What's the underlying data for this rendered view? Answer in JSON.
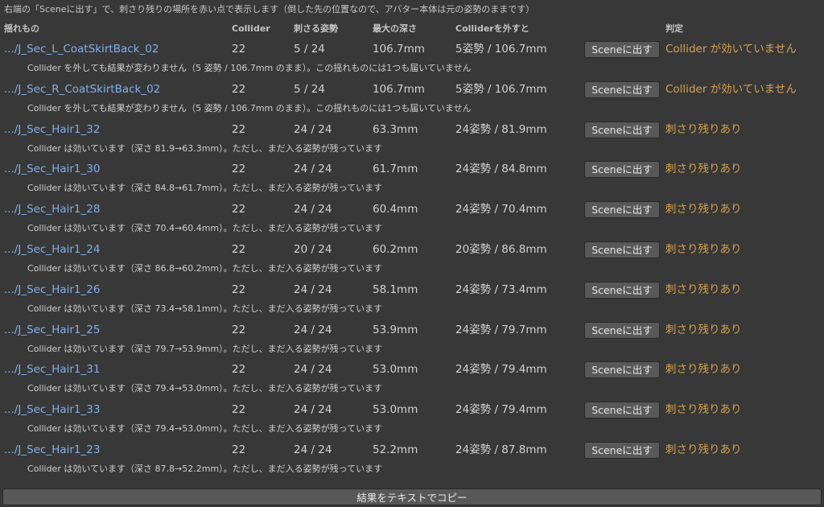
{
  "hint": "右端の「Sceneに出す」で、刺さり残りの場所を赤い点で表示します（倒した先の位置なので、アバター本体は元の姿勢のままです）",
  "header": {
    "col_bone": "揺れもの",
    "col_collider": "Collider",
    "col_poses": "刺さる姿勢",
    "col_depth": "最大の深さ",
    "col_remove": "Colliderを外すと",
    "col_verdict": "判定"
  },
  "colors": {
    "background": "#383838",
    "link": "#7fb0ea",
    "verdict": "#d6a24a",
    "button": "#585858"
  },
  "rows": [
    {
      "name": ".../J_Sec_L_CoatSkirtBack_02",
      "collider": "22",
      "poses": "5 / 24",
      "depth": "106.7mm",
      "remove": "5姿勢 / 106.7mm",
      "button": "Sceneに出す",
      "verdict": "Collider が効いていません",
      "detail": "Collider を外しても結果が変わりません（5 姿勢 / 106.7mm のまま）。この揺れものには1つも届いていません"
    },
    {
      "name": ".../J_Sec_R_CoatSkirtBack_02",
      "collider": "22",
      "poses": "5 / 24",
      "depth": "106.7mm",
      "remove": "5姿勢 / 106.7mm",
      "button": "Sceneに出す",
      "verdict": "Collider が効いていません",
      "detail": "Collider を外しても結果が変わりません（5 姿勢 / 106.7mm のまま）。この揺れものには1つも届いていません"
    },
    {
      "name": ".../J_Sec_Hair1_32",
      "collider": "22",
      "poses": "24 / 24",
      "depth": "63.3mm",
      "remove": "24姿勢 / 81.9mm",
      "button": "Sceneに出す",
      "verdict": "刺さり残りあり",
      "detail": "Collider は効いています（深さ 81.9→63.3mm）。ただし、まだ入る姿勢が残っています"
    },
    {
      "name": ".../J_Sec_Hair1_30",
      "collider": "22",
      "poses": "24 / 24",
      "depth": "61.7mm",
      "remove": "24姿勢 / 84.8mm",
      "button": "Sceneに出す",
      "verdict": "刺さり残りあり",
      "detail": "Collider は効いています（深さ 84.8→61.7mm）。ただし、まだ入る姿勢が残っています"
    },
    {
      "name": ".../J_Sec_Hair1_28",
      "collider": "22",
      "poses": "24 / 24",
      "depth": "60.4mm",
      "remove": "24姿勢 / 70.4mm",
      "button": "Sceneに出す",
      "verdict": "刺さり残りあり",
      "detail": "Collider は効いています（深さ 70.4→60.4mm）。ただし、まだ入る姿勢が残っています"
    },
    {
      "name": ".../J_Sec_Hair1_24",
      "collider": "22",
      "poses": "20 / 24",
      "depth": "60.2mm",
      "remove": "20姿勢 / 86.8mm",
      "button": "Sceneに出す",
      "verdict": "刺さり残りあり",
      "detail": "Collider は効いています（深さ 86.8→60.2mm）。ただし、まだ入る姿勢が残っています"
    },
    {
      "name": ".../J_Sec_Hair1_26",
      "collider": "22",
      "poses": "24 / 24",
      "depth": "58.1mm",
      "remove": "24姿勢 / 73.4mm",
      "button": "Sceneに出す",
      "verdict": "刺さり残りあり",
      "detail": "Collider は効いています（深さ 73.4→58.1mm）。ただし、まだ入る姿勢が残っています"
    },
    {
      "name": ".../J_Sec_Hair1_25",
      "collider": "22",
      "poses": "24 / 24",
      "depth": "53.9mm",
      "remove": "24姿勢 / 79.7mm",
      "button": "Sceneに出す",
      "verdict": "刺さり残りあり",
      "detail": "Collider は効いています（深さ 79.7→53.9mm）。ただし、まだ入る姿勢が残っています"
    },
    {
      "name": ".../J_Sec_Hair1_31",
      "collider": "22",
      "poses": "24 / 24",
      "depth": "53.0mm",
      "remove": "24姿勢 / 79.4mm",
      "button": "Sceneに出す",
      "verdict": "刺さり残りあり",
      "detail": "Collider は効いています（深さ 79.4→53.0mm）。ただし、まだ入る姿勢が残っています"
    },
    {
      "name": ".../J_Sec_Hair1_33",
      "collider": "22",
      "poses": "24 / 24",
      "depth": "53.0mm",
      "remove": "24姿勢 / 79.4mm",
      "button": "Sceneに出す",
      "verdict": "刺さり残りあり",
      "detail": "Collider は効いています（深さ 79.4→53.0mm）。ただし、まだ入る姿勢が残っています"
    },
    {
      "name": ".../J_Sec_Hair1_23",
      "collider": "22",
      "poses": "24 / 24",
      "depth": "52.2mm",
      "remove": "24姿勢 / 87.8mm",
      "button": "Sceneに出す",
      "verdict": "刺さり残りあり",
      "detail": "Collider は効いています（深さ 87.8→52.2mm）。ただし、まだ入る姿勢が残っています"
    }
  ],
  "copy_button": "結果をテキストでコピー"
}
